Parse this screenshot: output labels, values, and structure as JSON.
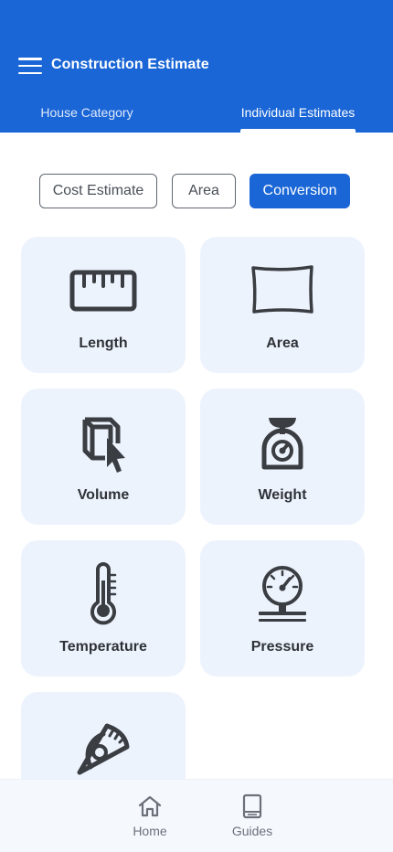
{
  "appbar": {
    "title": "Construction Estimate",
    "menu_icon": "hamburger-menu-icon",
    "color": "#1a66d6"
  },
  "tabs": [
    {
      "label": "House Category",
      "selected": false
    },
    {
      "label": "Individual Estimates",
      "selected": true
    }
  ],
  "chips": [
    {
      "label": "Cost Estimate",
      "selected": false
    },
    {
      "label": "Area",
      "selected": false
    },
    {
      "label": "Conversion",
      "selected": true
    }
  ],
  "cards": [
    {
      "label": "Length",
      "icon": "ruler-icon"
    },
    {
      "label": "Area",
      "icon": "area-icon"
    },
    {
      "label": "Volume",
      "icon": "volume-cube-icon"
    },
    {
      "label": "Weight",
      "icon": "weighing-scale-icon"
    },
    {
      "label": "Temperature",
      "icon": "thermometer-icon"
    },
    {
      "label": "Pressure",
      "icon": "pressure-gauge-icon"
    },
    {
      "label": "",
      "icon": "protractor-icon"
    }
  ],
  "bottom_nav": [
    {
      "label": "Home",
      "icon": "home-icon"
    },
    {
      "label": "Guides",
      "icon": "book-icon"
    }
  ],
  "colors": {
    "accent": "#1a66d6",
    "card_bg": "#edf3fd",
    "icon": "#3a3d42"
  }
}
